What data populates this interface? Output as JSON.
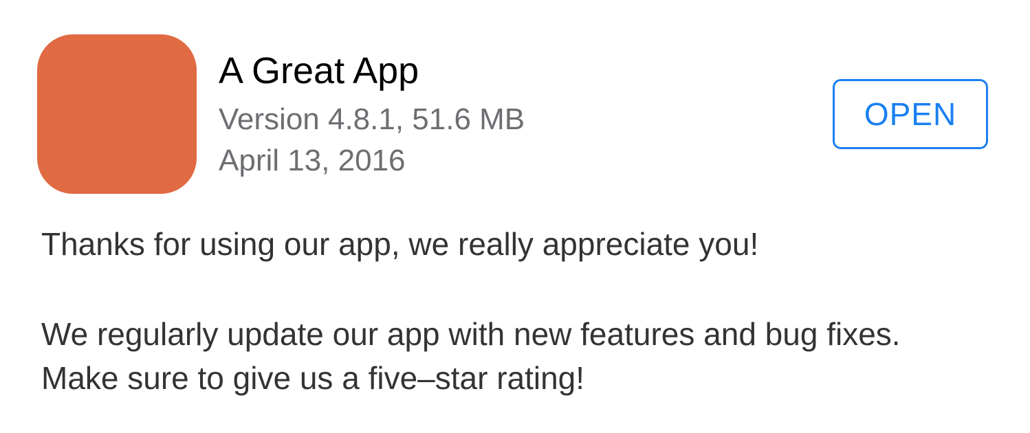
{
  "app": {
    "name": "A Great App",
    "version_size": "Version 4.8.1, 51.6 MB",
    "date": "April 13, 2016",
    "icon_color": "#e06a42"
  },
  "actions": {
    "open_label": "OPEN",
    "accent_color": "#1a7ff0"
  },
  "release_notes": {
    "paragraph_1": "Thanks for using our app, we really appreciate you!",
    "paragraph_2": "We regularly update our app with new features and bug fixes. Make sure to give us a five–star rating!"
  }
}
